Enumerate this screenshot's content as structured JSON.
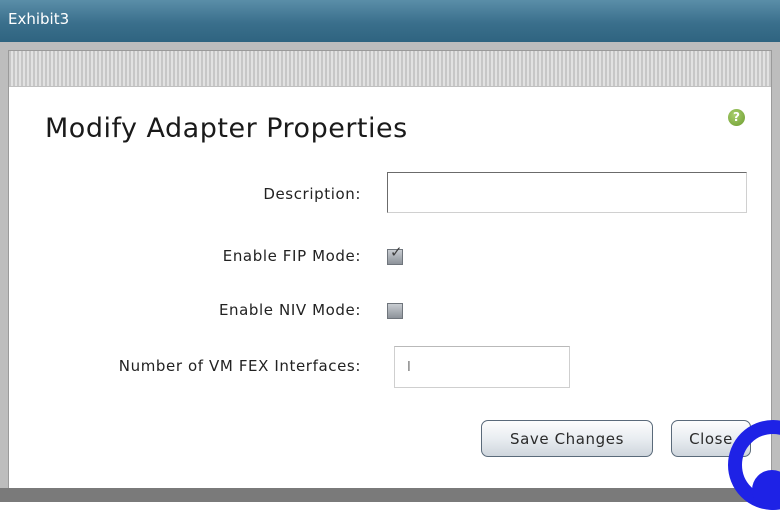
{
  "window": {
    "title": "Exhibit3"
  },
  "dialog": {
    "heading": "Modify Adapter Properties",
    "help_icon": "question-mark-icon",
    "help_glyph": "?",
    "fields": {
      "description_label": "Description:",
      "description_value": "",
      "fip_label": "Enable FIP Mode:",
      "fip_checked": true,
      "niv_label": "Enable NIV Mode:",
      "niv_checked": false,
      "vmfex_label": "Number of VM FEX Interfaces:",
      "vmfex_value": "I"
    },
    "buttons": {
      "save_label": "Save Changes",
      "close_label": "Close"
    }
  },
  "colors": {
    "titlebar": "#3a6f8c",
    "help_icon": "#6d9c2f",
    "corner_overlay": "#1e22e6"
  }
}
